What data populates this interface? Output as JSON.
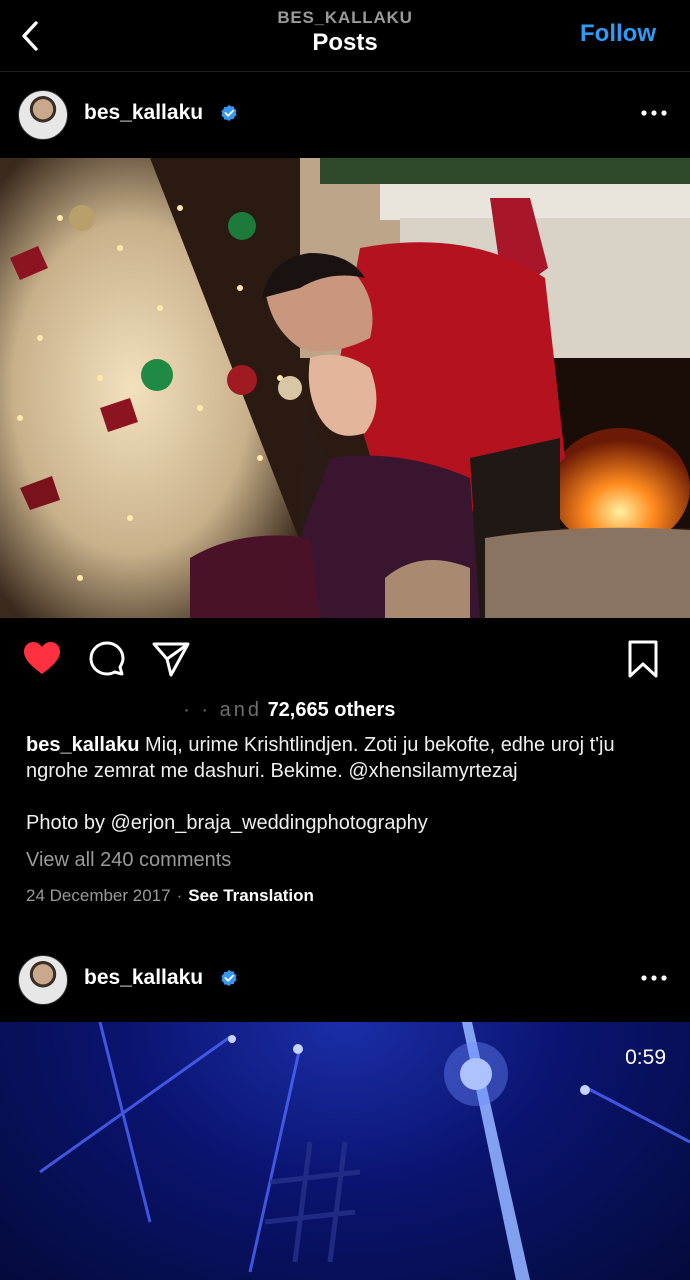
{
  "header": {
    "subtitle": "BES_KALLAKU",
    "title": "Posts",
    "follow_label": "Follow",
    "back_icon": "chevron-left-icon"
  },
  "post1": {
    "username": "bes_kallaku",
    "verified": true,
    "likes_prefix": "· · and",
    "likes_count": "72,665 others",
    "caption_user": "bes_kallaku",
    "caption_text": "Miq, urime Krishtlindjen. Zoti ju bekofte, edhe uroj t'ju ngrohe zemrat me dashuri. Bekime. @xhensilamyrtezaj",
    "credit": "Photo by @erjon_braja_weddingphotography",
    "view_comments": "View all 240 comments",
    "date": "24 December 2017",
    "separator": "·",
    "translate_label": "See Translation",
    "liked": true,
    "like_color": "#ff3040"
  },
  "post2": {
    "username": "bes_kallaku",
    "verified": true,
    "duration": "0:59"
  },
  "colors": {
    "accent": "#2f9bf7",
    "verified_badge": "#3897f0",
    "background": "#000000"
  }
}
